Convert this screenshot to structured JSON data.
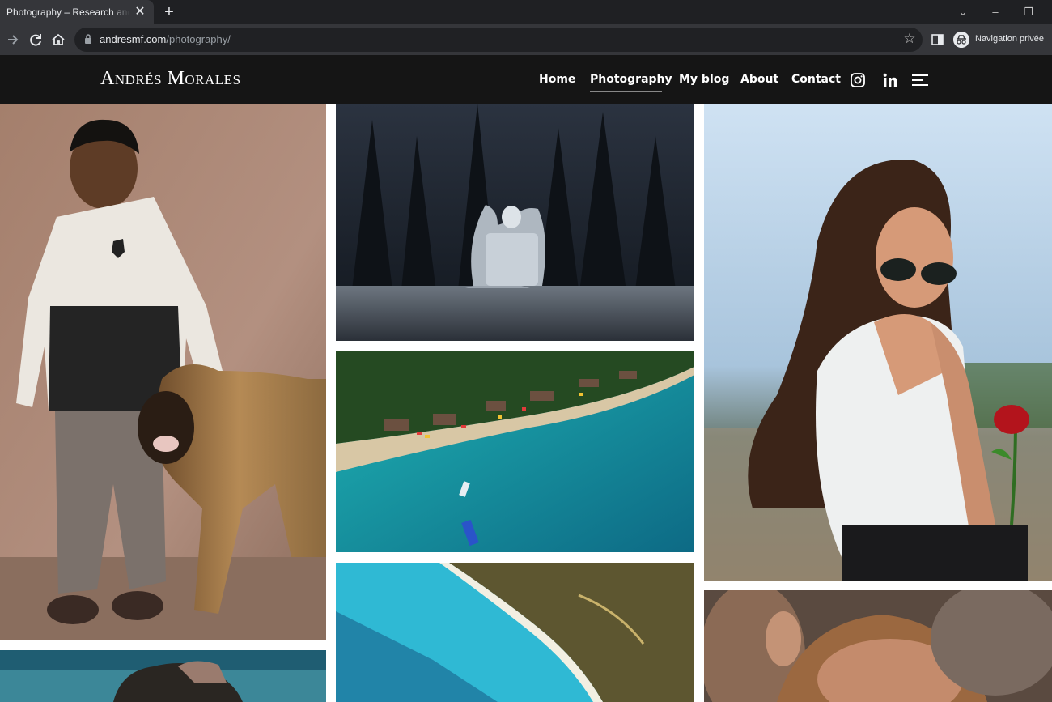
{
  "browser": {
    "tab_title": "Photography – Research and creativity",
    "tab_close_icon": "close-icon",
    "new_tab_icon": "plus-icon",
    "url_host": "andresmf.com",
    "url_path": "/photography/",
    "incognito_label": "Navigation privée"
  },
  "site": {
    "logo": "Andrés Morales",
    "nav": [
      {
        "label": "Home",
        "active": false
      },
      {
        "label": "Photography",
        "active": true
      },
      {
        "label": "My blog",
        "active": false
      },
      {
        "label": "About",
        "active": false
      },
      {
        "label": "Contact",
        "active": false
      }
    ],
    "social_icons": [
      "instagram-icon",
      "linkedin-icon"
    ],
    "menu_icon": "hamburger-menu-icon"
  },
  "colors": {
    "chrome_dark": "#1f2023",
    "chrome_toolbar": "#35363a",
    "site_header": "#151515"
  },
  "gallery": [
    {
      "id": "boy-with-dog"
    },
    {
      "id": "angel-statue-forest"
    },
    {
      "id": "aerial-beach"
    },
    {
      "id": "woman-with-rose"
    },
    {
      "id": "aerial-coastline"
    },
    {
      "id": "crowd-portrait"
    },
    {
      "id": "person-blue-sky"
    }
  ]
}
